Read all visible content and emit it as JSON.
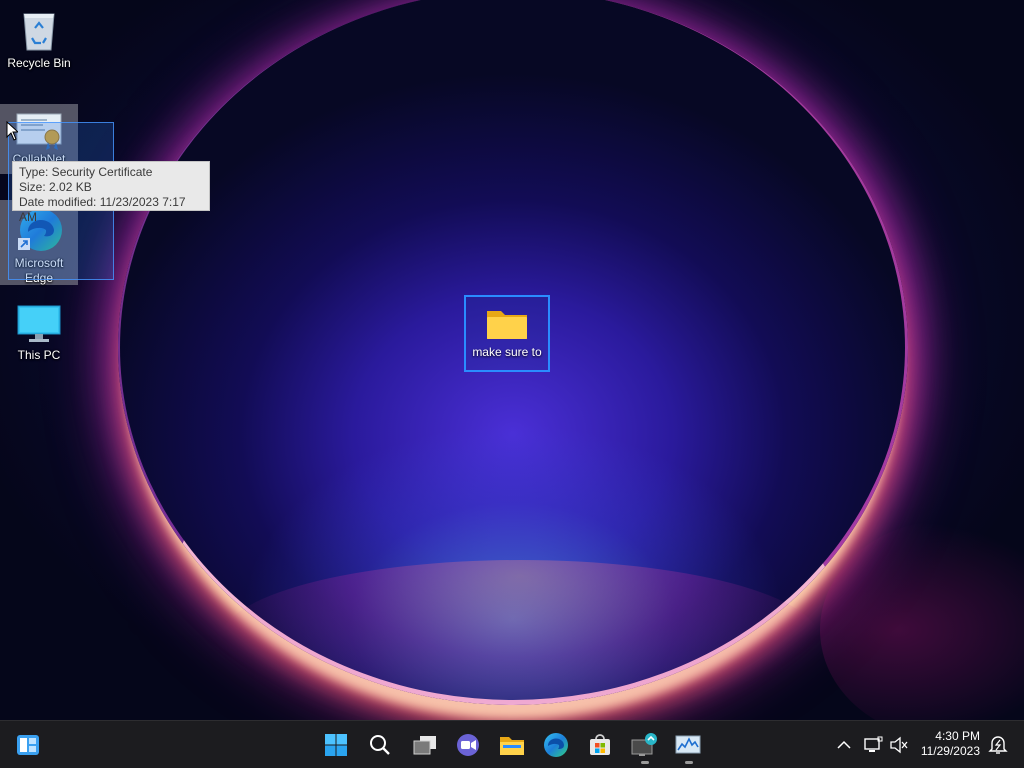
{
  "desktop": {
    "icons": [
      {
        "label": "Recycle Bin"
      },
      {
        "label": "CollabNet"
      },
      {
        "label": "Microsoft Edge"
      },
      {
        "label": "This PC"
      }
    ],
    "folder": {
      "label": "make sure to"
    },
    "tooltip": {
      "type_line": "Type: Security Certificate",
      "size_line": "Size: 2.02 KB",
      "date_line": "Date modified: 11/23/2023 7:17 AM"
    }
  },
  "taskbar": {
    "apps": [
      {
        "icon": "start-icon"
      },
      {
        "icon": "search-icon"
      },
      {
        "icon": "task-view-icon"
      },
      {
        "icon": "teams-chat-icon"
      },
      {
        "icon": "file-explorer-icon"
      },
      {
        "icon": "edge-icon"
      },
      {
        "icon": "store-icon"
      },
      {
        "icon": "remote-desktop-icon"
      },
      {
        "icon": "resource-monitor-icon"
      }
    ],
    "clock": {
      "time": "4:30 PM",
      "date": "11/29/2023"
    }
  },
  "colors": {
    "accent": "#2a8cff",
    "taskbar": "#1c1c1f",
    "tooltip_bg": "#e9e9e9"
  }
}
